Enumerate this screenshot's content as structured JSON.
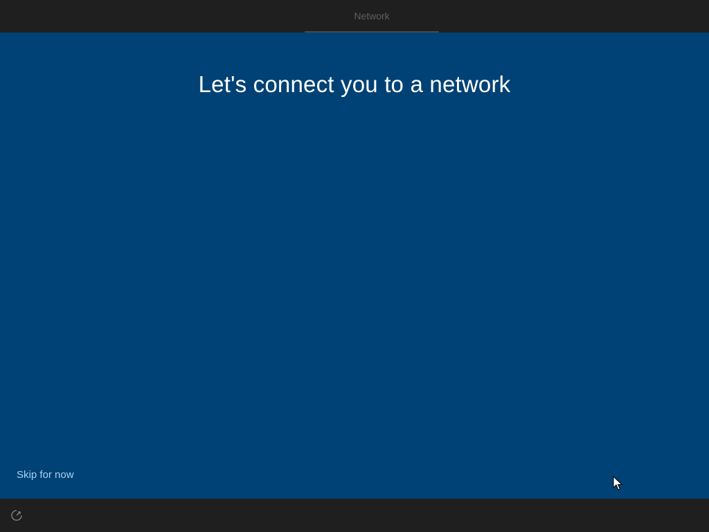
{
  "header": {
    "step_label": "Network"
  },
  "main": {
    "title": "Let's connect you to a network",
    "skip_label": "Skip for now"
  },
  "footer": {
    "accessibility_icon": "ease-of-access-icon"
  },
  "colors": {
    "chrome_bg": "#1f1f1f",
    "panel_bg": "#004275",
    "link": "#a9d1f2",
    "title": "#ffffff",
    "step_label": "#5e5e5e"
  }
}
